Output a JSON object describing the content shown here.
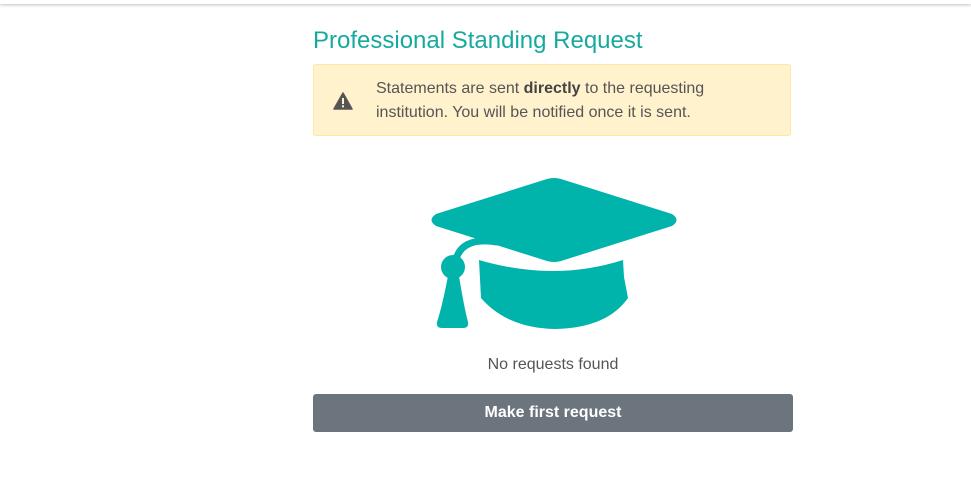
{
  "page": {
    "title": "Professional Standing Request"
  },
  "alert": {
    "icon": "warning-triangle-icon",
    "text_before": "Statements are sent ",
    "text_bold": "directly",
    "text_after": " to the requesting institution. You will be notified once it is sent."
  },
  "empty_state": {
    "icon": "graduation-cap-icon",
    "message": "No requests found",
    "button_label": "Make first request"
  },
  "colors": {
    "accent": "#17a9a0",
    "alert_background": "#fff2cc",
    "button": "#6c757d"
  }
}
